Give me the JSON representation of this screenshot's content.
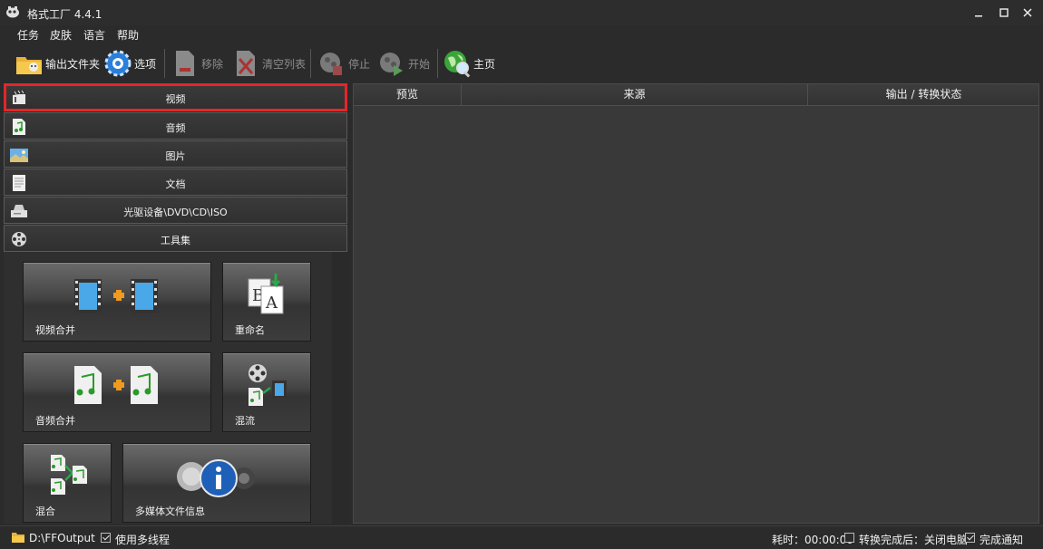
{
  "window": {
    "title": "格式工厂 4.4.1"
  },
  "menu": [
    "任务",
    "皮肤",
    "语言",
    "帮助"
  ],
  "toolbar": {
    "output_folder": "输出文件夹",
    "options": "选项",
    "remove": "移除",
    "clear_list": "清空列表",
    "stop": "停止",
    "start": "开始",
    "home": "主页"
  },
  "categories": [
    {
      "label": "视频",
      "icon": "film-icon",
      "selected": true
    },
    {
      "label": "音频",
      "icon": "music-note-icon"
    },
    {
      "label": "图片",
      "icon": "picture-icon"
    },
    {
      "label": "文档",
      "icon": "document-icon"
    },
    {
      "label": "光驱设备\\DVD\\CD\\ISO",
      "icon": "optical-drive-icon"
    },
    {
      "label": "工具集",
      "icon": "film-reel-icon"
    }
  ],
  "tools": [
    {
      "label": "视频合并",
      "icon": "video-merge-icon"
    },
    {
      "label": "重命名",
      "icon": "rename-icon"
    },
    {
      "label": "音频合并",
      "icon": "audio-merge-icon"
    },
    {
      "label": "混流",
      "icon": "mux-icon"
    },
    {
      "label": "混合",
      "icon": "mix-icon"
    },
    {
      "label": "多媒体文件信息",
      "icon": "media-info-icon"
    }
  ],
  "table": {
    "columns": [
      "预览",
      "来源",
      "输出 / 转换状态"
    ]
  },
  "status": {
    "output_path": "D:\\FFOutput",
    "multithread_label": "使用多线程",
    "multithread_checked": true,
    "elapsed": "耗时：00:00:00",
    "after_convert_label": "转换完成后：关闭电脑",
    "after_convert_checked": false,
    "notify_label": "完成通知",
    "notify_checked": true
  },
  "colors": {
    "selection_border": "#e5262a",
    "background": "#2b2b2b"
  }
}
